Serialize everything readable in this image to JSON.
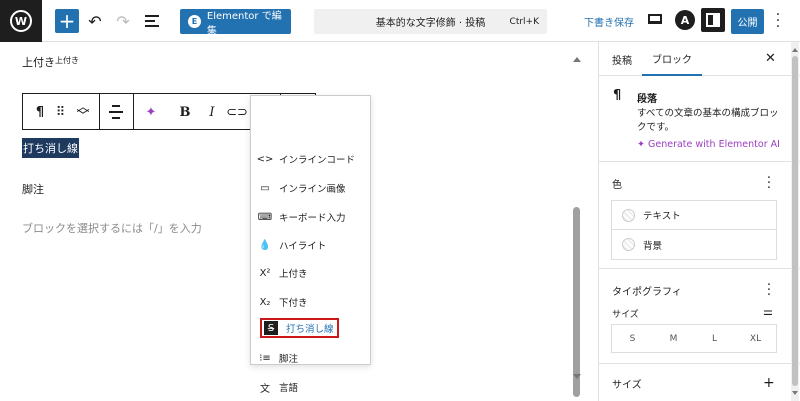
{
  "topbar": {
    "elementor_button": "Elementor で編集",
    "command_title": "基本的な文字修飾 · 投稿",
    "command_shortcut": "Ctrl+K",
    "save_draft": "下書き保存",
    "publish": "公開"
  },
  "canvas": {
    "superscript_line_base": "上付き",
    "superscript_line_sup": "上付き",
    "selected_text": "打ち消し線",
    "footnote_text": "脚注",
    "placeholder": "ブロックを選択するには「/」を入力"
  },
  "format_menu": {
    "items": [
      {
        "label": "インラインコード",
        "icon": "code-icon"
      },
      {
        "label": "インライン画像",
        "icon": "inline-image-icon"
      },
      {
        "label": "キーボード入力",
        "icon": "keyboard-icon"
      },
      {
        "label": "ハイライト",
        "icon": "highlight-drop-icon"
      },
      {
        "label": "上付き",
        "icon": "superscript-icon"
      },
      {
        "label": "下付き",
        "icon": "subscript-icon"
      },
      {
        "label": "打ち消し線",
        "icon": "strikethrough-icon",
        "active": true
      },
      {
        "label": "脚注",
        "icon": "footnote-icon"
      },
      {
        "label": "言語",
        "icon": "language-icon"
      }
    ]
  },
  "sidebar": {
    "tabs": [
      "投稿",
      "ブロック"
    ],
    "active_tab": "ブロック",
    "block_name": "段落",
    "block_description": "すべての文章の基本の構成ブロックです。",
    "ai_link": "Generate with Elementor AI",
    "color_title": "色",
    "color_rows": [
      "テキスト",
      "背景"
    ],
    "typography_title": "タイポグラフィ",
    "size_label": "サイズ",
    "size_options": [
      "S",
      "M",
      "L",
      "XL"
    ],
    "size_panel_title": "サイズ"
  },
  "colors": {
    "accent": "#2271b1",
    "highlight_border": "#cc1818",
    "ai_purple": "#9b3fc1"
  }
}
